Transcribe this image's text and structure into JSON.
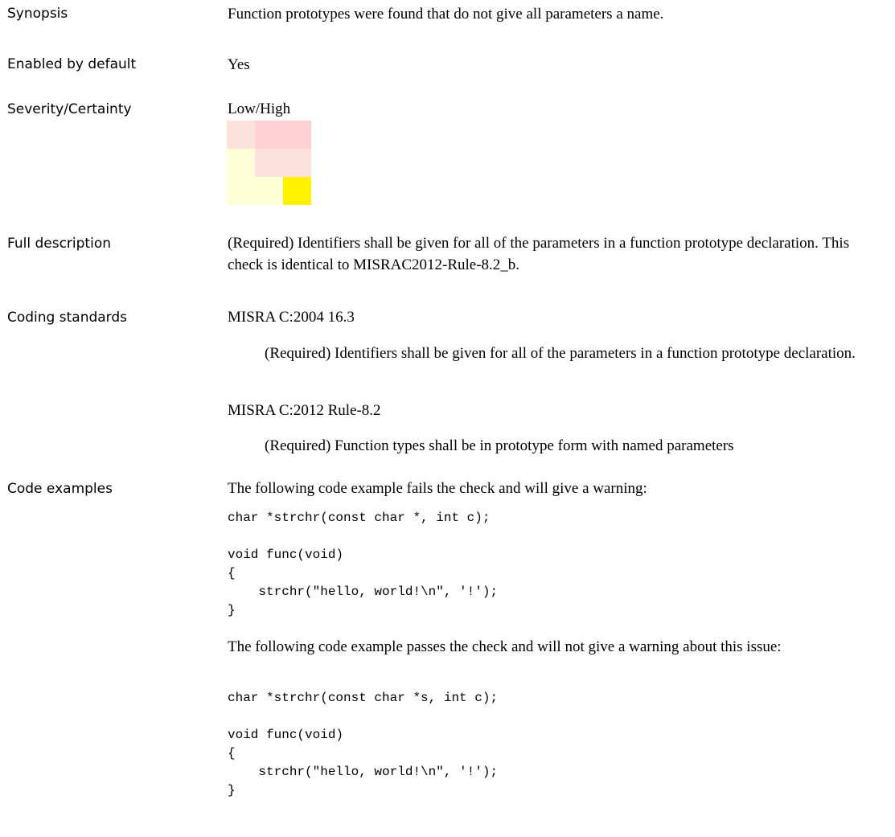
{
  "synopsis": {
    "label": "Synopsis",
    "text": "Function prototypes were found that do not give all parameters a name."
  },
  "enabled": {
    "label": "Enabled by default",
    "value": "Yes"
  },
  "severity": {
    "label": "Severity/Certainty",
    "value": "Low/High",
    "matrix_colors": [
      [
        "#fde2dc",
        "#ffd0d4",
        "#ffd0d4"
      ],
      [
        "#ffffd8",
        "#fde2dc",
        "#fde2dc"
      ],
      [
        "#ffffd8",
        "#ffffd8",
        "#fff200"
      ]
    ]
  },
  "full_description": {
    "label": "Full description",
    "text": " (Required) Identifiers shall be given for all of the parameters in a function prototype declaration. This check is identical to MISRAC2012-Rule-8.2_b."
  },
  "coding_standards": {
    "label": "Coding standards",
    "items": [
      {
        "name": "MISRA C:2004 16.3",
        "description": "(Required) Identifiers shall be given for all of the parameters in a function prototype declaration."
      },
      {
        "name": "MISRA C:2012 Rule-8.2",
        "description": "(Required) Function types shall be in prototype form with named parameters"
      }
    ]
  },
  "code_examples": {
    "label": "Code examples",
    "fail_intro": "The following code example fails the check and will give a warning:",
    "fail_code": "char *strchr(const char *, int c);\n\nvoid func(void)\n{\n    strchr(\"hello, world!\\n\", '!');\n}",
    "pass_intro": "The following code example passes the check and will not give a warning about this issue:",
    "pass_code": "char *strchr(const char *s, int c);\n\nvoid func(void)\n{\n    strchr(\"hello, world!\\n\", '!');\n}"
  }
}
